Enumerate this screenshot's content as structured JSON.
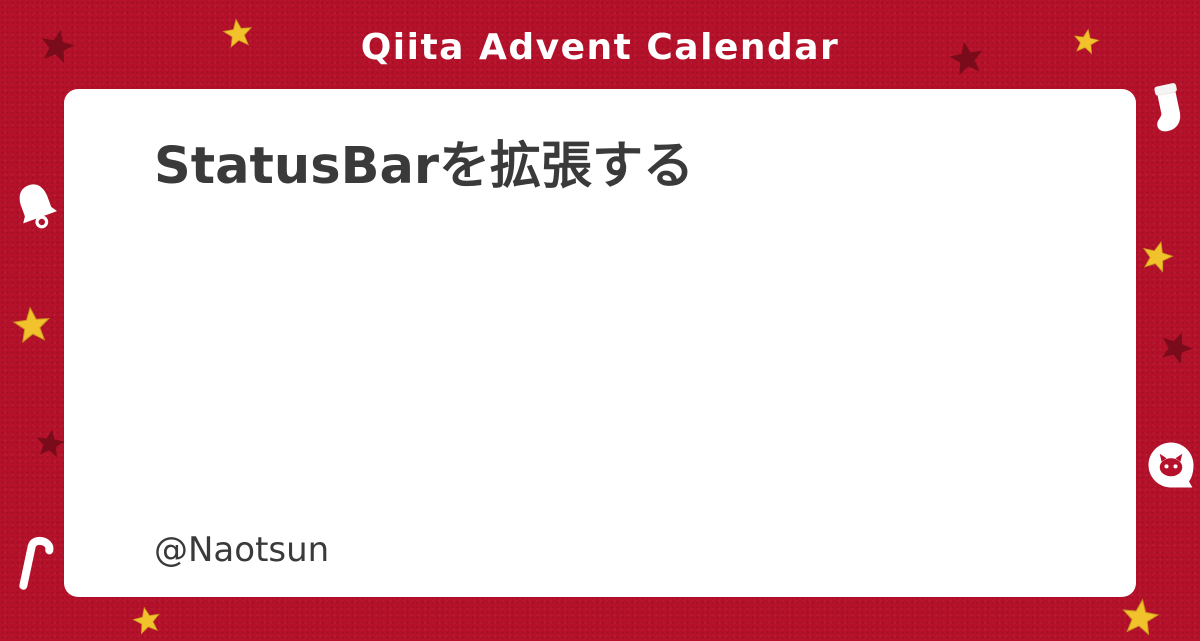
{
  "header": {
    "title": "Qiita Advent Calendar"
  },
  "article": {
    "title": "StatusBarを拡張する",
    "author": "@Naotsun"
  },
  "decorations": {
    "icons": [
      "gold-star-icon",
      "dark-star-icon",
      "stocking-icon",
      "bell-icon",
      "candy-cane-icon",
      "qiita-cat-icon"
    ]
  },
  "colors": {
    "background": "#b5112a",
    "card": "#ffffff",
    "text": "#3a3a3a",
    "header_text": "#ffffff",
    "gold_star": "#f2c22c",
    "dark_star": "#7a0b1a"
  }
}
